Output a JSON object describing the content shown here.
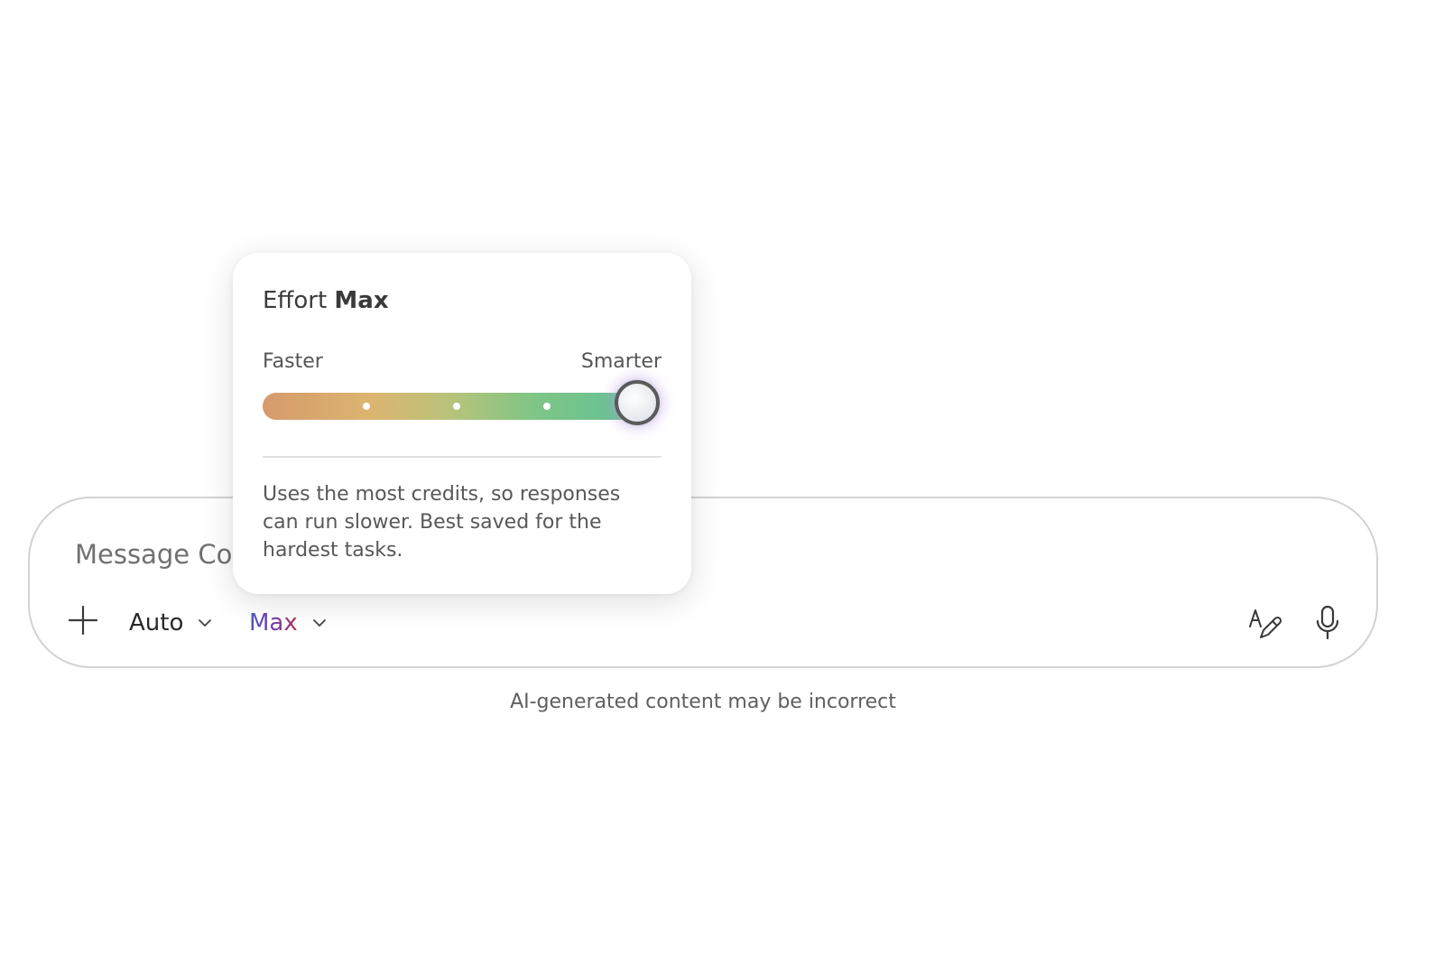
{
  "composer": {
    "placeholder": "Message Copilot",
    "model_label": "Auto",
    "effort_label": "Max"
  },
  "icons": {
    "add": "plus-icon",
    "model_dropdown": "chevron-down-icon",
    "effort_dropdown": "chevron-down-icon",
    "write": "handwriting-pen-icon",
    "mic": "microphone-icon"
  },
  "popover": {
    "title_prefix": "Effort",
    "title_level": "Max",
    "min_label": "Faster",
    "max_label": "Smarter",
    "steps": 5,
    "selected_step": 5,
    "description": "Uses the most credits, so responses can run slower. Best saved for the hardest tasks."
  },
  "footer": {
    "disclaimer": "AI-generated content may be incorrect"
  },
  "colors": {
    "effort_gradient": [
      "#4b57c7",
      "#b2324d"
    ],
    "track_gradient": [
      "#d69a6c",
      "#5fc197"
    ],
    "border": "#d2d2d2"
  }
}
